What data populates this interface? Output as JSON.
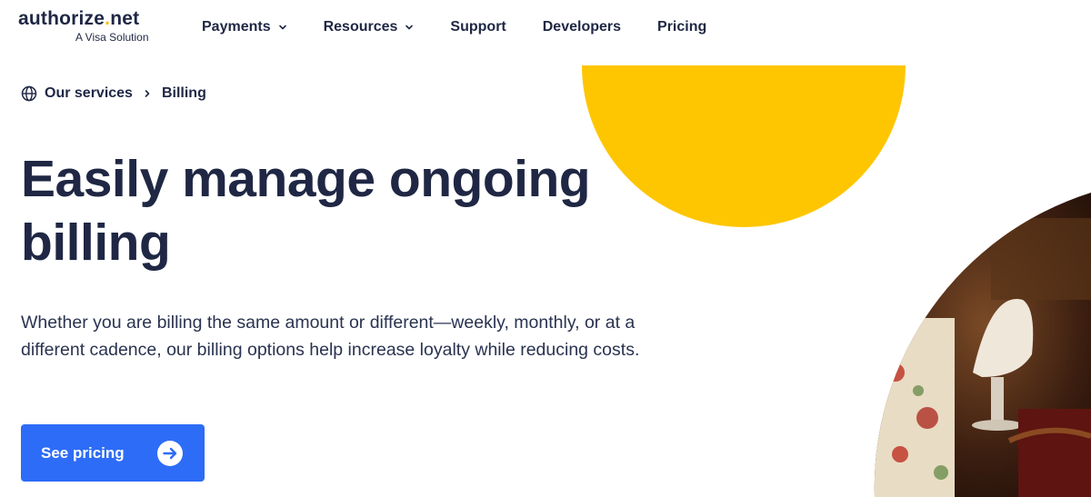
{
  "brand": {
    "name_main": "authorize",
    "name_dot": ".",
    "name_tld": "net",
    "tagline": "A Visa Solution",
    "accent_color": "#f6bf00"
  },
  "nav": {
    "items": [
      {
        "label": "Payments",
        "has_dropdown": true
      },
      {
        "label": "Resources",
        "has_dropdown": true
      },
      {
        "label": "Support",
        "has_dropdown": false
      },
      {
        "label": "Developers",
        "has_dropdown": false
      },
      {
        "label": "Pricing",
        "has_dropdown": false
      }
    ]
  },
  "breadcrumb": {
    "icon": "globe-icon",
    "items": [
      "Our services",
      "Billing"
    ]
  },
  "hero": {
    "title": "Easily manage ongoing billing",
    "description": "Whether you are billing the same amount or different—weekly, monthly, or at a different cadence, our billing options help increase loyalty while reducing costs.",
    "cta_label": "See pricing",
    "cta_icon": "arrow-right-circle-icon",
    "cta_color": "#2d6cf6"
  },
  "decor": {
    "shape_color": "#fec601",
    "photo_subject": "restaurant-interior"
  }
}
